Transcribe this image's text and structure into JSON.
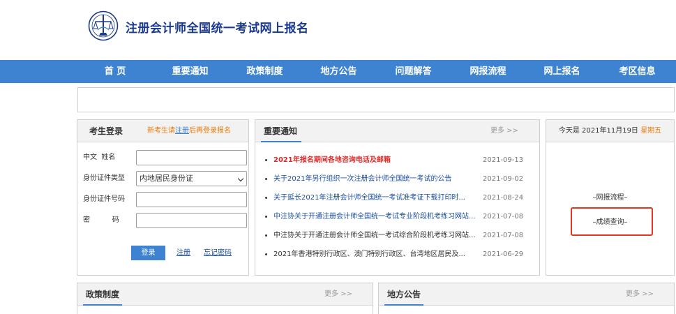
{
  "header": {
    "title": "注册会计师全国统一考试网上报名",
    "logo_icon": "cicpa-emblem-icon"
  },
  "nav": {
    "items": [
      "首 页",
      "重要通知",
      "政策制度",
      "地方公告",
      "问题解答",
      "网报流程",
      "网上报名",
      "考区信息"
    ]
  },
  "login": {
    "title": "考生登录",
    "tip_before": "新考生请",
    "tip_link": "注册",
    "tip_after": "后再登录报名",
    "name_label": "中文  姓名",
    "id_type_label": "身份证件类型",
    "id_type_value": "内地居民身份证",
    "id_number_label": "身份证件号码",
    "password_label": "密          码",
    "login_button": "登录",
    "register_link": "注册",
    "forgot_link": "忘记密码"
  },
  "notice": {
    "title": "重要通知",
    "more": "更多 >>",
    "items": [
      {
        "title": "2021年报名期间各地咨询电话及邮箱",
        "date": "2021-09-13"
      },
      {
        "title": "关于2021年另行组织一次注册会计师全国统一考试的公告",
        "date": "2021-09-02"
      },
      {
        "title": "关于延长2021年注册会计师全国统一考试准考证下载打印时...",
        "date": "2021-08-24"
      },
      {
        "title": "中注协关于开通注册会计师全国统一考试专业阶段机考练习网站...",
        "date": "2021-07-08"
      },
      {
        "title": "中注协关于开通注册会计师全国统一考试综合阶段机考练习网站...",
        "date": "2021-07-08"
      },
      {
        "title": "2021年香港特别行政区、澳门特别行政区、台湾地区居民及...",
        "date": "2021-06-29"
      }
    ]
  },
  "side": {
    "date_prefix": "今天是 2021年11月19日",
    "weekday": "星期五",
    "process_link": "–网报流程–",
    "score_link": "–成绩查询–",
    "highlight_color": "#e3351f"
  },
  "policy": {
    "title": "政策制度",
    "more": "更多 >>"
  },
  "local": {
    "title": "地方公告",
    "more": "更多 >>"
  },
  "colors": {
    "nav_bg": "#3d83d2",
    "title_blue": "#1b3a8f",
    "accent_orange": "#ec7c0e",
    "notice_red": "#e02a2a"
  }
}
